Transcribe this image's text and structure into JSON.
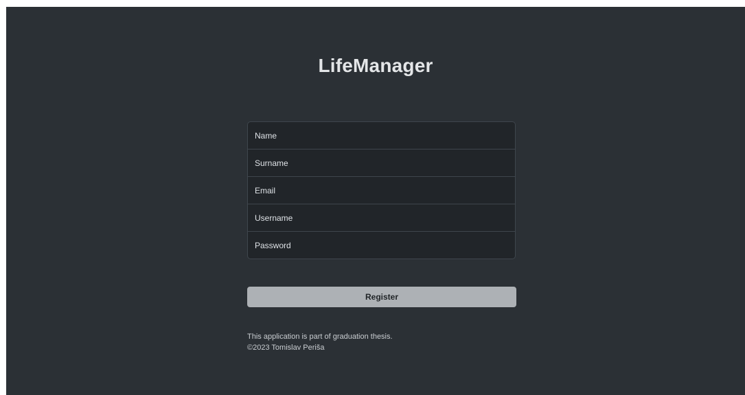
{
  "app": {
    "title": "LifeManager"
  },
  "form": {
    "name_placeholder": "Name",
    "surname_placeholder": "Surname",
    "email_placeholder": "Email",
    "username_placeholder": "Username",
    "password_placeholder": "Password",
    "submit_label": "Register"
  },
  "footer": {
    "line1": "This application is part of graduation thesis.",
    "line2": "©2023 Tomislav Periša"
  },
  "colors": {
    "background": "#2b3035",
    "field_background": "#212529",
    "button_background": "#adb1b5"
  }
}
